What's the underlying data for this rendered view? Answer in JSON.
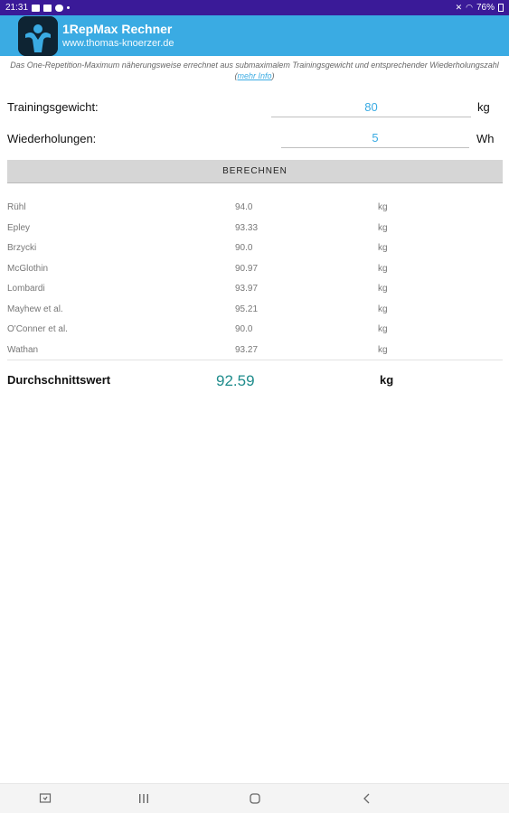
{
  "status_bar": {
    "time": "21:31",
    "battery": "76%"
  },
  "app_bar": {
    "title": "1RepMax Rechner",
    "subtitle": "www.thomas-knoerzer.de"
  },
  "description": {
    "text": "Das One-Repetition-Maximum näherungsweise errechnet aus submaximalem Trainingsgewicht und entsprechender Wiederholungszahl (",
    "link": "mehr Info",
    "suffix": ")"
  },
  "form": {
    "weight": {
      "label": "Trainingsgewicht:",
      "value": "80",
      "unit": "kg"
    },
    "reps": {
      "label": "Wiederholungen:",
      "value": "5",
      "unit": "Wh"
    },
    "calculate_label": "BERECHNEN"
  },
  "results": [
    {
      "name": "Rühl",
      "value": "94.0",
      "unit": "kg"
    },
    {
      "name": "Epley",
      "value": "93.33",
      "unit": "kg"
    },
    {
      "name": "Brzycki",
      "value": "90.0",
      "unit": "kg"
    },
    {
      "name": "McGlothin",
      "value": "90.97",
      "unit": "kg"
    },
    {
      "name": "Lombardi",
      "value": "93.97",
      "unit": "kg"
    },
    {
      "name": "Mayhew et al.",
      "value": "95.21",
      "unit": "kg"
    },
    {
      "name": "O'Conner et al.",
      "value": "90.0",
      "unit": "kg"
    },
    {
      "name": "Wathan",
      "value": "93.27",
      "unit": "kg"
    }
  ],
  "average": {
    "label": "Durchschnittswert",
    "value": "92.59",
    "unit": "kg"
  },
  "colors": {
    "status_bar": "#3a1a98",
    "app_bar": "#3aabe3",
    "accent": "#3aabe3",
    "average_value": "#1f8c8c"
  }
}
